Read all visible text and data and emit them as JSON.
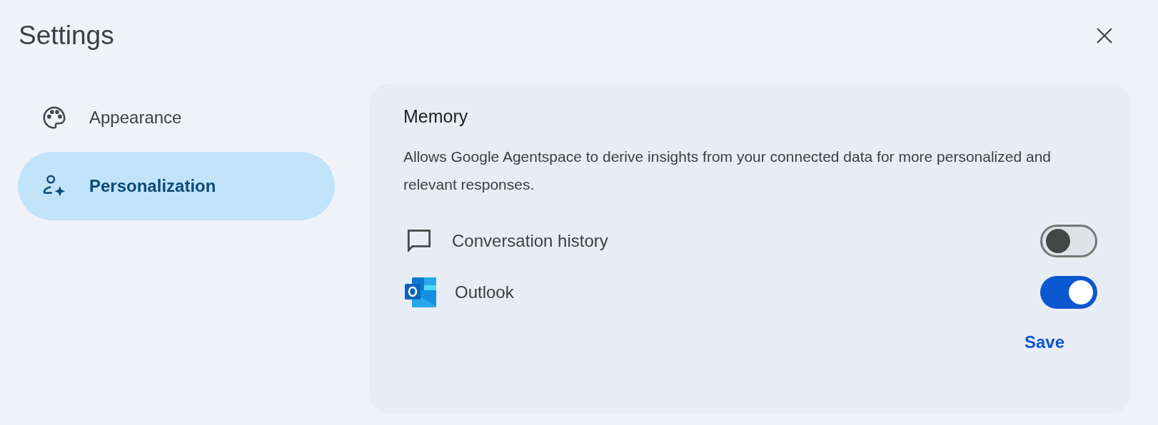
{
  "window": {
    "title": "Settings"
  },
  "sidebar": {
    "items": [
      {
        "label": "Appearance",
        "selected": false
      },
      {
        "label": "Personalization",
        "selected": true
      }
    ]
  },
  "panel": {
    "title": "Memory",
    "description": "Allows Google Agentspace to derive insights from your connected data for more personalized and relevant responses.",
    "settings": [
      {
        "label": "Conversation history",
        "on": false
      },
      {
        "label": "Outlook",
        "on": true
      }
    ],
    "save_button": "Save"
  }
}
